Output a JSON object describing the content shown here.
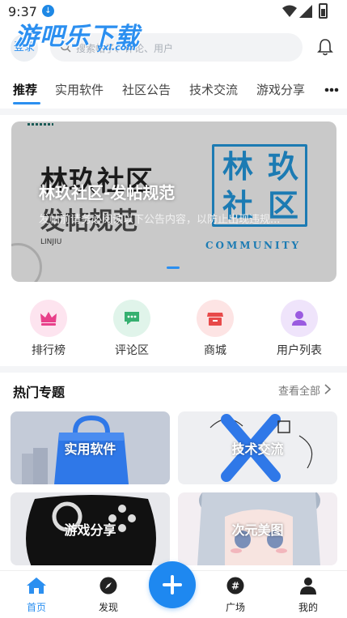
{
  "status_bar": {
    "time": "9:37"
  },
  "header": {
    "brand": "游吧乐下载",
    "brand_sub": "yxl.com",
    "login_label": "登录",
    "search_placeholder": "搜索帖子、评论、用户"
  },
  "tabs": [
    "推荐",
    "实用软件",
    "社区公告",
    "技术交流",
    "游戏分享"
  ],
  "banner": {
    "art_title_line1": "林玖社区",
    "art_title_line2": "发帖规范",
    "art_small": "LINJIU",
    "seal_chars": [
      "林",
      "玖",
      "社",
      "区"
    ],
    "seal_word": "COMMUNITY",
    "title": "林玖社区-发帖规范",
    "subtitle": "发帖前请务必阅读以下公告内容，以防止出现违规..."
  },
  "quick_links": [
    {
      "label": "排行榜",
      "icon": "crown-icon",
      "bg": "#fde4ef",
      "fg": "#e8408a"
    },
    {
      "label": "评论区",
      "icon": "chat-icon",
      "bg": "#e0f4ea",
      "fg": "#35b070"
    },
    {
      "label": "商城",
      "icon": "store-icon",
      "bg": "#fde4e4",
      "fg": "#e84a4a"
    },
    {
      "label": "用户列表",
      "icon": "user-icon",
      "bg": "#efe4fb",
      "fg": "#9a5be0"
    }
  ],
  "hot": {
    "title": "热门专题",
    "see_all": "查看全部",
    "cards": [
      {
        "label": "实用软件"
      },
      {
        "label": "技术交流"
      },
      {
        "label": "游戏分享"
      },
      {
        "label": "次元美图"
      }
    ]
  },
  "bottom_nav": [
    {
      "label": "首页",
      "icon": "home-icon"
    },
    {
      "label": "发现",
      "icon": "compass-icon"
    },
    {
      "label": "广场",
      "icon": "hashtag-icon"
    },
    {
      "label": "我的",
      "icon": "person-icon"
    }
  ],
  "colors": {
    "accent": "#2b8ff0",
    "seal": "#1c7bb3"
  }
}
